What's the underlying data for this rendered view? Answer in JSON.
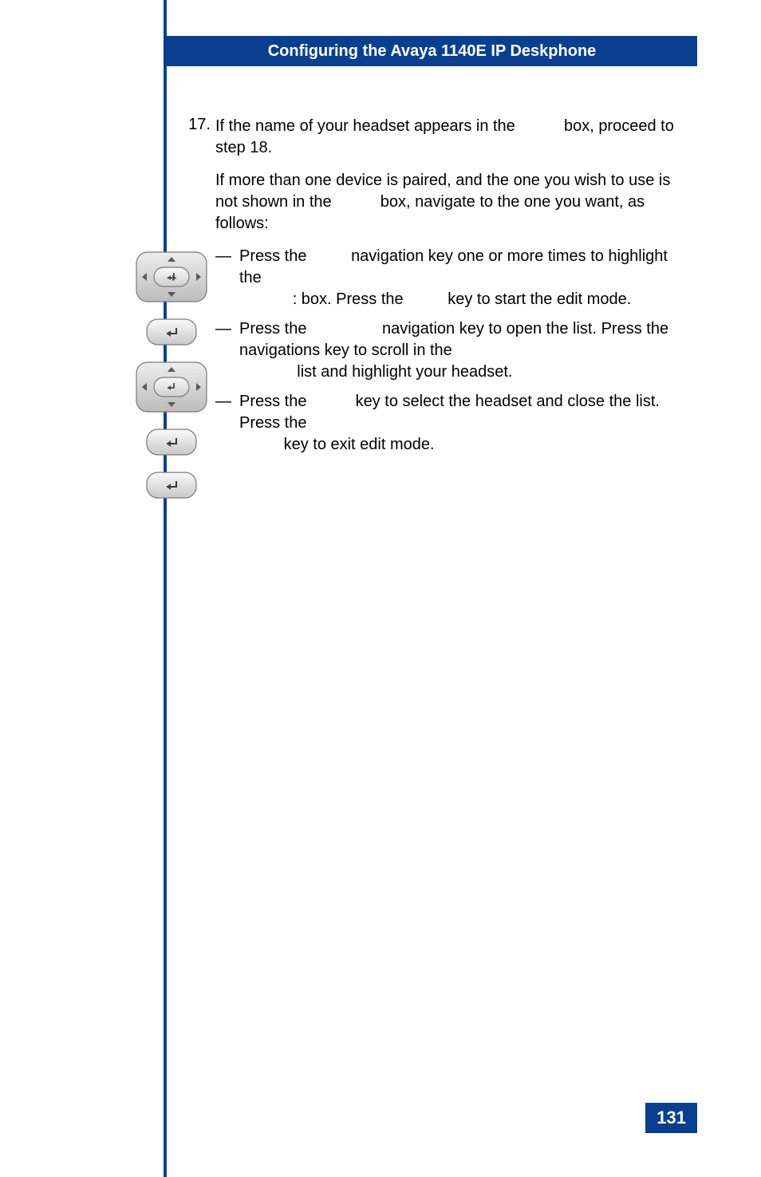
{
  "header": {
    "title": "Configuring the Avaya 1140E IP Deskphone"
  },
  "step": {
    "number": "17.",
    "intro_a": "If the name of your headset appears in the",
    "intro_b": "box, proceed to step 18.",
    "para2_a": "If more than one device is paired, and the one you wish to use is not shown in the",
    "para2_b": "box, navigate to the one you want, as follows:",
    "b1_a": "Press the",
    "b1_b": "navigation key one or more times to highlight the",
    "b1_c": ": box. Press the",
    "b1_d": "key to start the edit mode.",
    "b2_a": "Press the",
    "b2_b": "navigation key to open the list. Press the navigations key to scroll in the",
    "b2_c": "list and highlight your headset.",
    "b3_a": "Press the",
    "b3_b": "key to select the headset and close the list. Press the",
    "b3_c": "key to exit edit mode."
  },
  "dash": "—",
  "pageNumber": "131"
}
